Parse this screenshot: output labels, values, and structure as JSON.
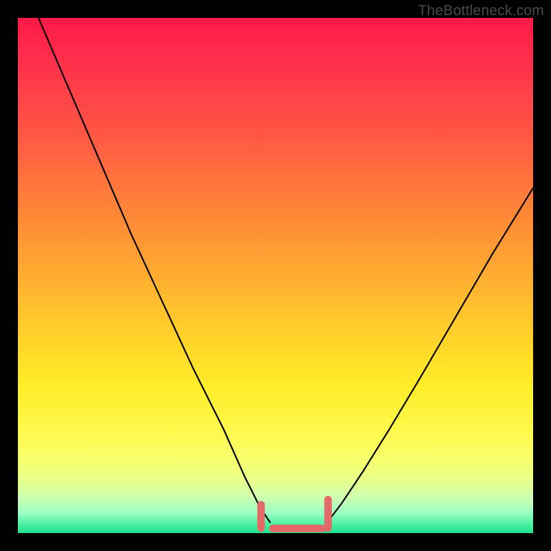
{
  "watermark": {
    "text": "TheBottleneck.com"
  },
  "chart_data": {
    "type": "line",
    "title": "",
    "xlabel": "",
    "ylabel": "",
    "xlim": [
      0,
      100
    ],
    "ylim": [
      0,
      100
    ],
    "grid": false,
    "legend": false,
    "background_gradient": {
      "direction": "vertical",
      "stops": [
        {
          "pos": 0,
          "color": "#ff1a47"
        },
        {
          "pos": 0.5,
          "color": "#ffb030"
        },
        {
          "pos": 0.8,
          "color": "#fff94c"
        },
        {
          "pos": 1.0,
          "color": "#1fe08e"
        }
      ]
    },
    "series": [
      {
        "name": "left-arm",
        "stroke": "#000000",
        "stroke_width": 2.2,
        "x": [
          4,
          10,
          16,
          22,
          28,
          34,
          40,
          44,
          47,
          49
        ],
        "y": [
          100,
          86,
          72,
          58,
          45,
          32,
          20,
          11,
          5,
          2
        ]
      },
      {
        "name": "right-arm",
        "stroke": "#000000",
        "stroke_width": 2.2,
        "x": [
          60,
          63,
          67,
          72,
          78,
          85,
          92,
          100
        ],
        "y": [
          2,
          6,
          12,
          20,
          30,
          42,
          54,
          67
        ]
      },
      {
        "name": "valley-marker",
        "stroke": "#e46a6a",
        "stroke_width": 11,
        "linecap": "round",
        "segments": [
          {
            "x": [
              47.2,
              47.2
            ],
            "y": [
              1.0,
              5.5
            ]
          },
          {
            "x": [
              49.5,
              59.0
            ],
            "y": [
              0.9,
              0.9
            ]
          },
          {
            "x": [
              60.2,
              60.2
            ],
            "y": [
              1.0,
              6.5
            ]
          }
        ]
      }
    ]
  }
}
